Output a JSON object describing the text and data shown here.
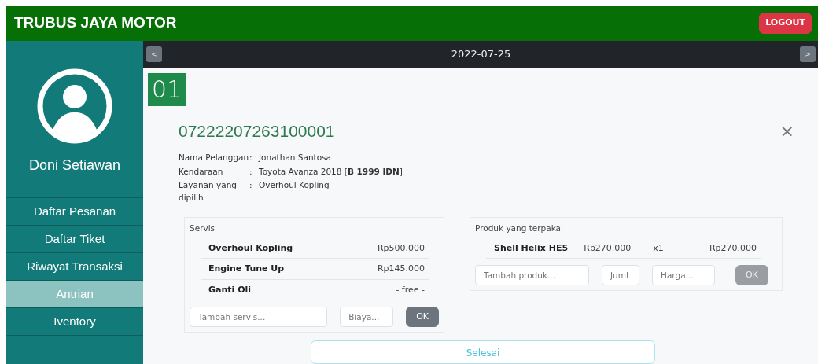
{
  "header": {
    "brand": "TRUBUS JAYA MOTOR",
    "logout": "LOGOUT"
  },
  "sidebar": {
    "user_name": "Doni Setiawan",
    "items": [
      {
        "label": "Daftar Pesanan",
        "selected": false
      },
      {
        "label": "Daftar Tiket",
        "selected": false
      },
      {
        "label": "Riwayat Transaksi",
        "selected": false
      },
      {
        "label": "Antrian",
        "selected": true
      },
      {
        "label": "Iventory",
        "selected": false
      }
    ]
  },
  "date_bar": {
    "prev": "<",
    "date": "2022-07-25",
    "next": ">"
  },
  "queue_number": "01",
  "order": {
    "number": "07222207263100001",
    "close": "×",
    "info": [
      {
        "label": "Nama Pelanggan",
        "sep": ":",
        "value": "Jonathan Santosa"
      },
      {
        "label": "Kendaraan",
        "sep": ":",
        "value": "Toyota Avanza 2018 [**B 1999 IDN**]"
      },
      {
        "label": "Layanan yang dipilih",
        "sep": ":",
        "value": "Overhoul Kopling"
      }
    ]
  },
  "services": {
    "title": "Servis",
    "rows": [
      {
        "name": "Overhoul Kopling",
        "price": "Rp500.000"
      },
      {
        "name": "Engine Tune Up",
        "price": "Rp145.000"
      },
      {
        "name": "Ganti Oli",
        "price": "- free -"
      }
    ],
    "name_placeholder": "Tambah servis...",
    "cost_placeholder": "Biaya...",
    "ok": "OK",
    "ok_disabled": false
  },
  "products": {
    "title": "Produk yang terpakai",
    "rows": [
      {
        "name": "Shell Helix HE5",
        "price": "Rp270.000",
        "qty": "x1",
        "total": "Rp270.000"
      }
    ],
    "name_placeholder": "Tambah produk...",
    "qty_placeholder": "Juml",
    "price_placeholder": "Harga...",
    "ok": "OK",
    "ok_disabled": true
  },
  "finish": "Selesai"
}
